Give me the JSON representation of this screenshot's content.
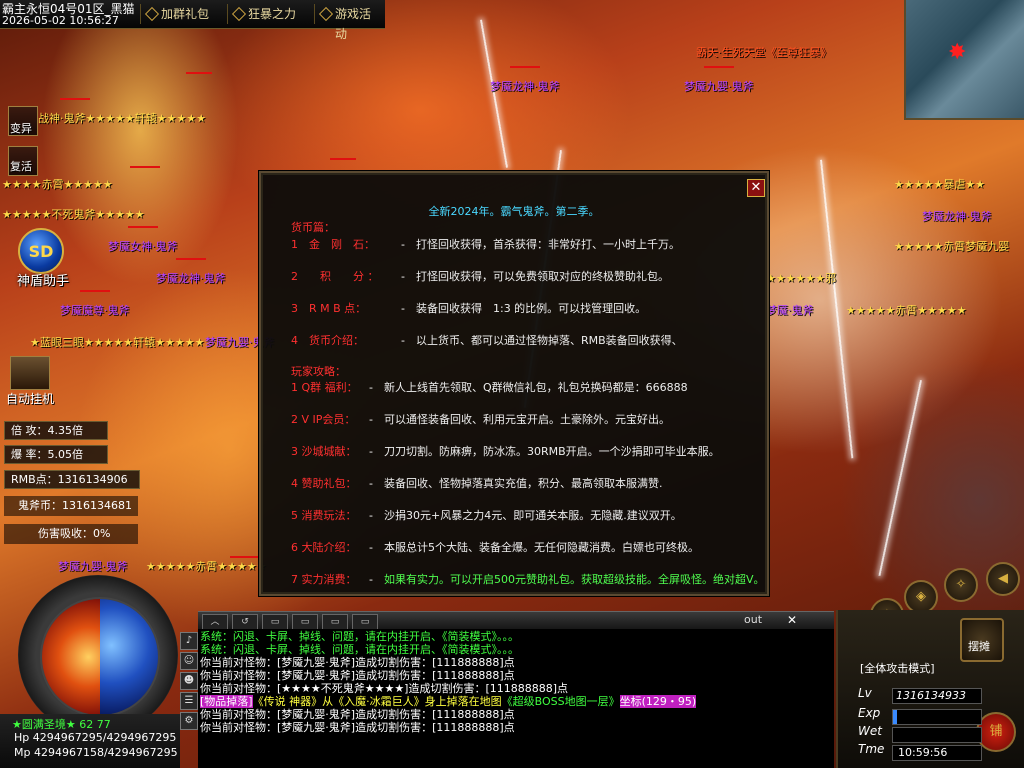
{
  "topbar": {
    "server": "霸主永恒04号01区_黑猫",
    "datetime": "2026-05-02 10:56:27",
    "buttons": [
      "加群礼包",
      "狂暴之力",
      "游戏活动"
    ]
  },
  "left_skills": {
    "transform": "变异",
    "revive": "复活",
    "helper": "神盾助手",
    "helper_logo": "SD",
    "auto_hang": "自动挂机"
  },
  "left_stats": {
    "attack": "倍 攻：4.35倍",
    "drop": "爆 率：5.05倍",
    "rmb": "RMB点：1316134906",
    "coin": "鬼斧币：1316134681",
    "absorb": "伤害吸收：0%"
  },
  "overhead_names": [
    "战神·鬼斧★★★★★轩辕★★★★★",
    "★★★★赤霄★★★★★",
    "★★★★★不死鬼斧★★★★★",
    "梦魇女神·鬼斧",
    "梦魇龙神·鬼斧",
    "梦魇魔尊·鬼斧",
    "★蓝眼三眼★★★★★轩辕★★★★★",
    "梦魇九婴·鬼斧",
    "梦魇九婴·鬼斧",
    "★★★★★赤霄★★★★★",
    "霸天·生死天堂《至尊狂暴》",
    "梦魇龙神·鬼斧",
    "梦魇九婴·鬼斧",
    "★★★★★暴虐★★",
    "梦魇龙神·鬼斧",
    "★★★★★赤霄梦魇九婴",
    "★★★★★★邪",
    "★★★★★赤霄★★★★★",
    "梦魇·鬼斧"
  ],
  "dialog": {
    "title": "全新2024年。霸气鬼斧。第二季。",
    "section1": "货币篇：",
    "currency": [
      {
        "key": "1　金　刚　石：",
        "value": "打怪回收获得，首杀获得：非常好打、一小时上千万。"
      },
      {
        "key": "2　　积　　分 ：",
        "value": "打怪回收获得，可以免费领取对应的终极赞助礼包。"
      },
      {
        "key": "3　R M B 点：",
        "value": "装备回收获得　1:3 的比例。可以找管理回收。"
      },
      {
        "key": "4　货币介绍：",
        "value": "以上货币、都可以通过怪物掉落、RMB装备回收获得、"
      }
    ],
    "section2": "玩家攻略：",
    "guide": [
      {
        "key": "1 Q群 福利：",
        "value": "新人上线首先领取、Q群微信礼包，礼包兑换码都是：666888"
      },
      {
        "key": "2 V IP会员：",
        "value": "可以通怪装备回收、利用元宝开启。土豪除外。元宝好出。"
      },
      {
        "key": "3 沙城城献：",
        "value": "刀刀切割。防麻痹，防冰冻。30RMB开启。一个沙捐即可毕业本服。"
      },
      {
        "key": "4 赞助礼包：",
        "value": "装备回收、怪物掉落真实充值，积分、最高领取本服满赞."
      },
      {
        "key": "5 消费玩法：",
        "value": "沙捐30元+风暴之力4元、即可通关本服。无隐藏.建议双开。"
      },
      {
        "key": "6 大陆介绍：",
        "value": "本服总计5个大陆、装备全爆。无任何隐藏消费。白嫖也可终极。"
      },
      {
        "key": "7 实力消费：",
        "value": "如果有实力。可以开启500元赞助礼包。获取超级技能。全屏吸怪。绝对超V。"
      }
    ],
    "close": "✕"
  },
  "chat": {
    "tab_out": "out",
    "tab_close": "✕",
    "lines": [
      {
        "text": "系统：闪退、卡屏、掉线、问题，请在内挂开启、《简装模式》。。。",
        "color": "#40ff40"
      },
      {
        "text": "系统：闪退、卡屏、掉线、问题，请在内挂开启、《简装模式》。。。",
        "color": "#40ff40"
      },
      {
        "text": "你当前对怪物：[梦魇九婴·鬼斧]造成切割伤害：[111888888]点",
        "color": "#ffffff"
      },
      {
        "text": "你当前对怪物：[梦魇九婴·鬼斧]造成切割伤害：[111888888]点",
        "color": "#ffffff"
      },
      {
        "text": "你当前对怪物：[★★★★不死鬼斧★★★★]造成切割伤害：[111888888]点",
        "color": "#ffffff"
      },
      {
        "text": "你当前对怪物：[梦魇九婴·鬼斧]造成切割伤害：[111888888]点",
        "color": "#ffffff"
      },
      {
        "text": "你当前对怪物：[梦魇九婴·鬼斧]造成切割伤害：[111888888]点",
        "color": "#ffffff"
      }
    ],
    "drop_line": {
      "tag": "[物品掉落]",
      "p1": "《传说 神器》从《入魔·冰霜巨人》身上掉落在地图",
      "map": "《超级BOSS地图一层》",
      "coords": "坐标(129・95)"
    }
  },
  "player": {
    "title": "★圆满圣境★ 62 77",
    "hp": "Hp  4294967295/4294967295",
    "mp": "Mp  4294967158/4294967295"
  },
  "right_panel": {
    "mode": "[全体攻击模式]",
    "lv_label": "Lv",
    "lv_value": "1316134933",
    "exp_label": "Exp",
    "wet_label": "Wet",
    "time_label": "Tme",
    "time_value": "10:59:56",
    "stall": "摆摊",
    "shop": "铺"
  },
  "colors": {
    "gold": "#ffd84a",
    "purple": "#b040ff",
    "red": "#ff3030",
    "cyan": "#4ad8ff",
    "green": "#40ff40"
  }
}
